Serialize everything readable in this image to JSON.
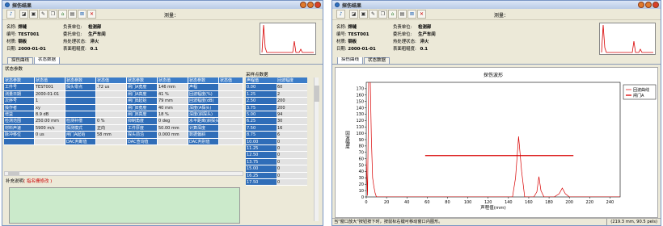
{
  "window_title": "探伤结果",
  "toolbar": {
    "measure_label": "测量："
  },
  "info": {
    "name_label": "名称:",
    "name_value": "焊缝",
    "id_label": "编号:",
    "id_value": "TEST001",
    "material_label": "材质:",
    "material_value": "钢板",
    "date_label": "日期:",
    "date_value": "2000-01-01",
    "unit_label": "负责单位:",
    "unit_value": "检测部",
    "client_label": "委托单位:",
    "client_value": "生产车间",
    "heat_label": "热处理状态:",
    "heat_value": "淬火",
    "rough_label": "表面粗糙度:",
    "rough_value": "0.1"
  },
  "tabs": [
    "探伤曲线",
    "状态数据"
  ],
  "left_active_tab": 1,
  "right_active_tab": 0,
  "status_section_title": "状态参数",
  "status_table": {
    "header": [
      "状态参数",
      "状态值",
      "状态参数",
      "状态值",
      "状态参数",
      "状态值",
      "状态参数",
      "状态值"
    ],
    "rows": [
      [
        "工件号",
        "TEST001",
        "探头零点",
        ".72 us",
        "闸门A宽度",
        "146 mm",
        "声程",
        ""
      ],
      [
        "测量日期",
        "2000-01-01",
        "",
        "",
        "闸门A高度",
        "41 %",
        "回波幅度(%)",
        ""
      ],
      [
        "次序号",
        "1",
        "",
        "",
        "闸门B起始",
        "79 mm",
        "回波幅度(dB)",
        ""
      ],
      [
        "操作者",
        "xy",
        "",
        "",
        "闸门B宽度",
        "40 mm",
        "深度(A探头)",
        ""
      ],
      [
        "增益",
        "8.9 dB",
        "",
        "",
        "闸门B高度",
        "18 %",
        "深度(斜探头)",
        ""
      ],
      [
        "检测范围",
        "250.00 mm",
        "检测补偿",
        "0 %",
        "抑制角度",
        "0 deg",
        "水平距离(斜探头)",
        ""
      ],
      [
        "材料声速",
        "5900 m/s",
        "探测模式",
        "正向",
        "工件厚度",
        "50.00 mm",
        "计算深度",
        ""
      ],
      [
        "脉冲移位",
        "0 us",
        "闸门A起始",
        "58 mm",
        "探头前沿",
        "0.000 mm",
        "数据偏斜",
        ""
      ],
      [
        "",
        "",
        "DAC判断值",
        "",
        "DAC查询值",
        "",
        "DAC判别值",
        ""
      ]
    ]
  },
  "sample_section_title": "采样点数据",
  "sample_table": {
    "header": [
      "声程值",
      "回波幅度"
    ],
    "rows": [
      [
        "0.00",
        "60"
      ],
      [
        "1.25",
        "2"
      ],
      [
        "2.50",
        "200"
      ],
      [
        "3.75",
        "200"
      ],
      [
        "5.00",
        "94"
      ],
      [
        "6.25",
        "30"
      ],
      [
        "7.50",
        "16"
      ],
      [
        "8.75",
        "6"
      ],
      [
        "10.00",
        "0"
      ],
      [
        "11.25",
        "0"
      ],
      [
        "12.50",
        "0"
      ],
      [
        "13.75",
        "0"
      ],
      [
        "15.00",
        "0"
      ],
      [
        "16.25",
        "0"
      ],
      [
        "17.50",
        "0"
      ]
    ]
  },
  "supplement_label": "补充说明",
  "supplement_hint": "( 指名栅修改 )",
  "status_bar_text": "当\"窗口放大\"按钮按下时，按鼠标右键可移动窗口内图形。",
  "status_bar_coords": "(219.3 mm, 90.5 pels)",
  "colors": {
    "table_header": "#3b7cc8",
    "curve": "#d80000",
    "supplement_bg": "#cbeacb"
  },
  "chart_data": {
    "type": "line",
    "title": "探伤波形",
    "xlabel": "声程值(mm)",
    "ylabel": "回波幅度",
    "xlim": [
      0,
      250
    ],
    "ylim": [
      0,
      180
    ],
    "x_ticks": [
      0,
      20,
      40,
      60,
      80,
      100,
      120,
      140,
      160,
      180,
      200,
      220,
      240
    ],
    "y_ticks": [
      0,
      10,
      20,
      30,
      40,
      50,
      60,
      70,
      80,
      90,
      100,
      110,
      120,
      130,
      140,
      150,
      160,
      170
    ],
    "legend": [
      "回波曲线",
      "闸门A"
    ],
    "legend_position": "top-right",
    "series": [
      {
        "name": "回波曲线",
        "x": [
          0,
          1.25,
          2.5,
          3.75,
          5,
          6.25,
          7.5,
          8.75,
          10,
          20,
          140,
          144,
          147,
          150,
          153,
          156,
          165,
          168,
          170,
          172,
          175,
          185,
          190,
          193,
          196,
          200,
          250
        ],
        "y": [
          60,
          2,
          200,
          200,
          94,
          30,
          16,
          6,
          0,
          0,
          0,
          0,
          30,
          95,
          40,
          0,
          0,
          8,
          32,
          10,
          0,
          0,
          5,
          14,
          5,
          0,
          0
        ]
      },
      {
        "name": "闸门A",
        "x": [
          58,
          204
        ],
        "y": [
          65,
          65
        ]
      }
    ]
  }
}
